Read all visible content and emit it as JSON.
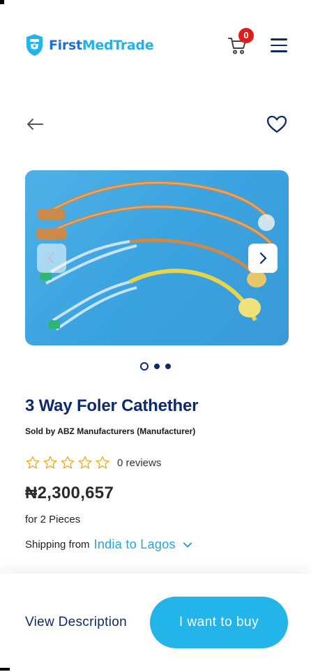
{
  "header": {
    "logo_first": "First",
    "logo_med": "MedTrade",
    "cart_count": "0"
  },
  "product": {
    "title": "3 Way Foler Cathether",
    "seller": "Sold by ABZ Manufacturers (Manufacturer)",
    "rating_stars": 0,
    "reviews": "0 reviews",
    "price": "₦2,300,657",
    "quantity": "for 2 Pieces",
    "shipping_label": "Shipping from",
    "shipping_route": "India to Lagos"
  },
  "carousel": {
    "slide_count": 3,
    "active_index": 0
  },
  "actions": {
    "view_description": "View Description",
    "buy": "I want to buy"
  },
  "colors": {
    "brand_navy": "#0f2a6b",
    "brand_blue": "#23b5ea",
    "badge_red": "#e31b1b",
    "star_gold": "#f0a81a"
  }
}
